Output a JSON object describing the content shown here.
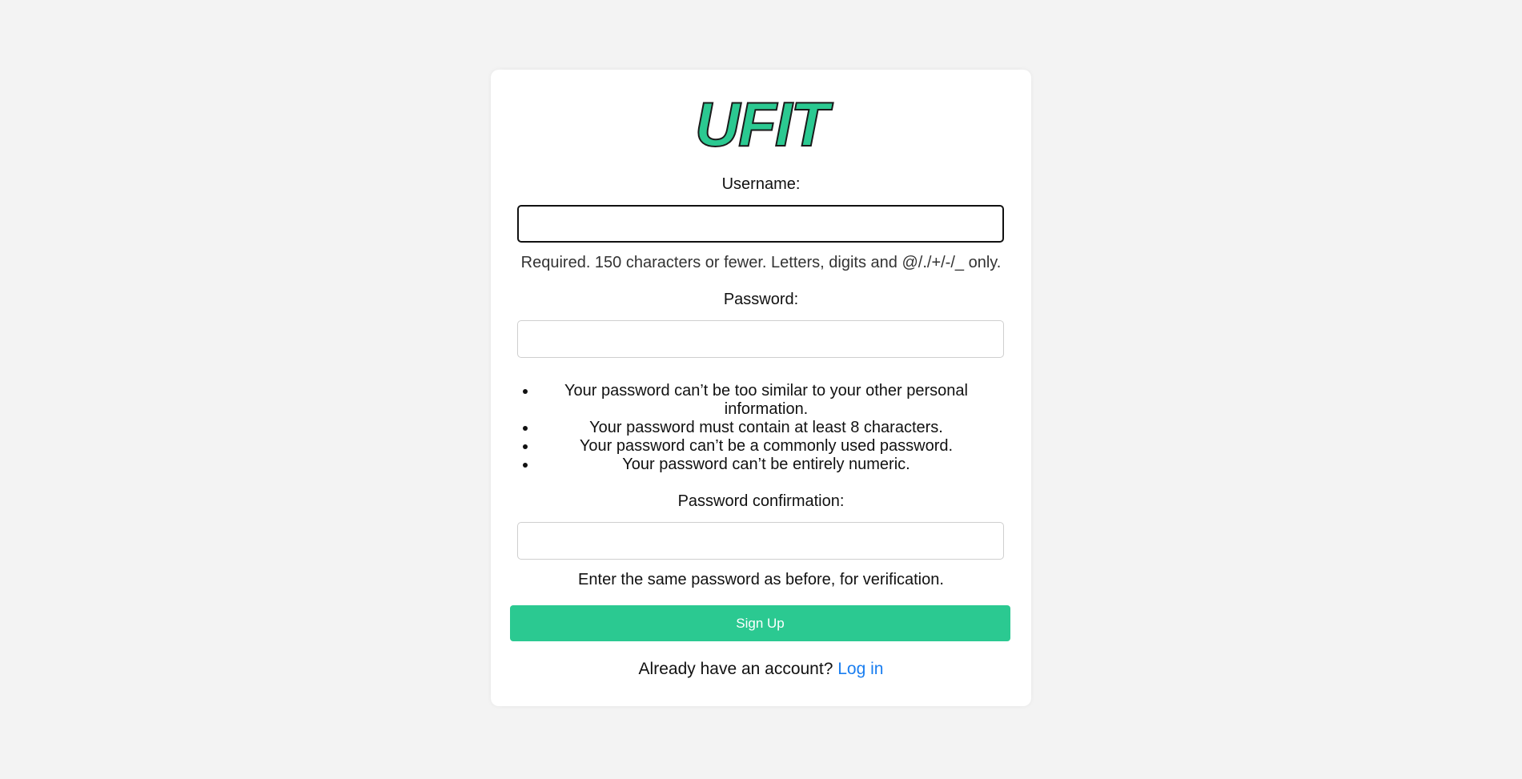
{
  "brand": {
    "logo_text": "UFIT",
    "accent_color": "#2bc991",
    "link_color": "#1a7ef0"
  },
  "form": {
    "username": {
      "label": "Username:",
      "value": "",
      "help": "Required. 150 characters or fewer. Letters, digits and @/./+/-/_ only."
    },
    "password": {
      "label": "Password:",
      "value": "",
      "rules": [
        "Your password can’t be too similar to your other personal information.",
        "Your password must contain at least 8 characters.",
        "Your password can’t be a commonly used password.",
        "Your password can’t be entirely numeric."
      ]
    },
    "password_confirmation": {
      "label": "Password confirmation:",
      "value": "",
      "help": "Enter the same password as before, for verification."
    },
    "submit_label": "Sign Up"
  },
  "footer": {
    "prompt": "Already have an account?",
    "login_link": "Log in"
  }
}
